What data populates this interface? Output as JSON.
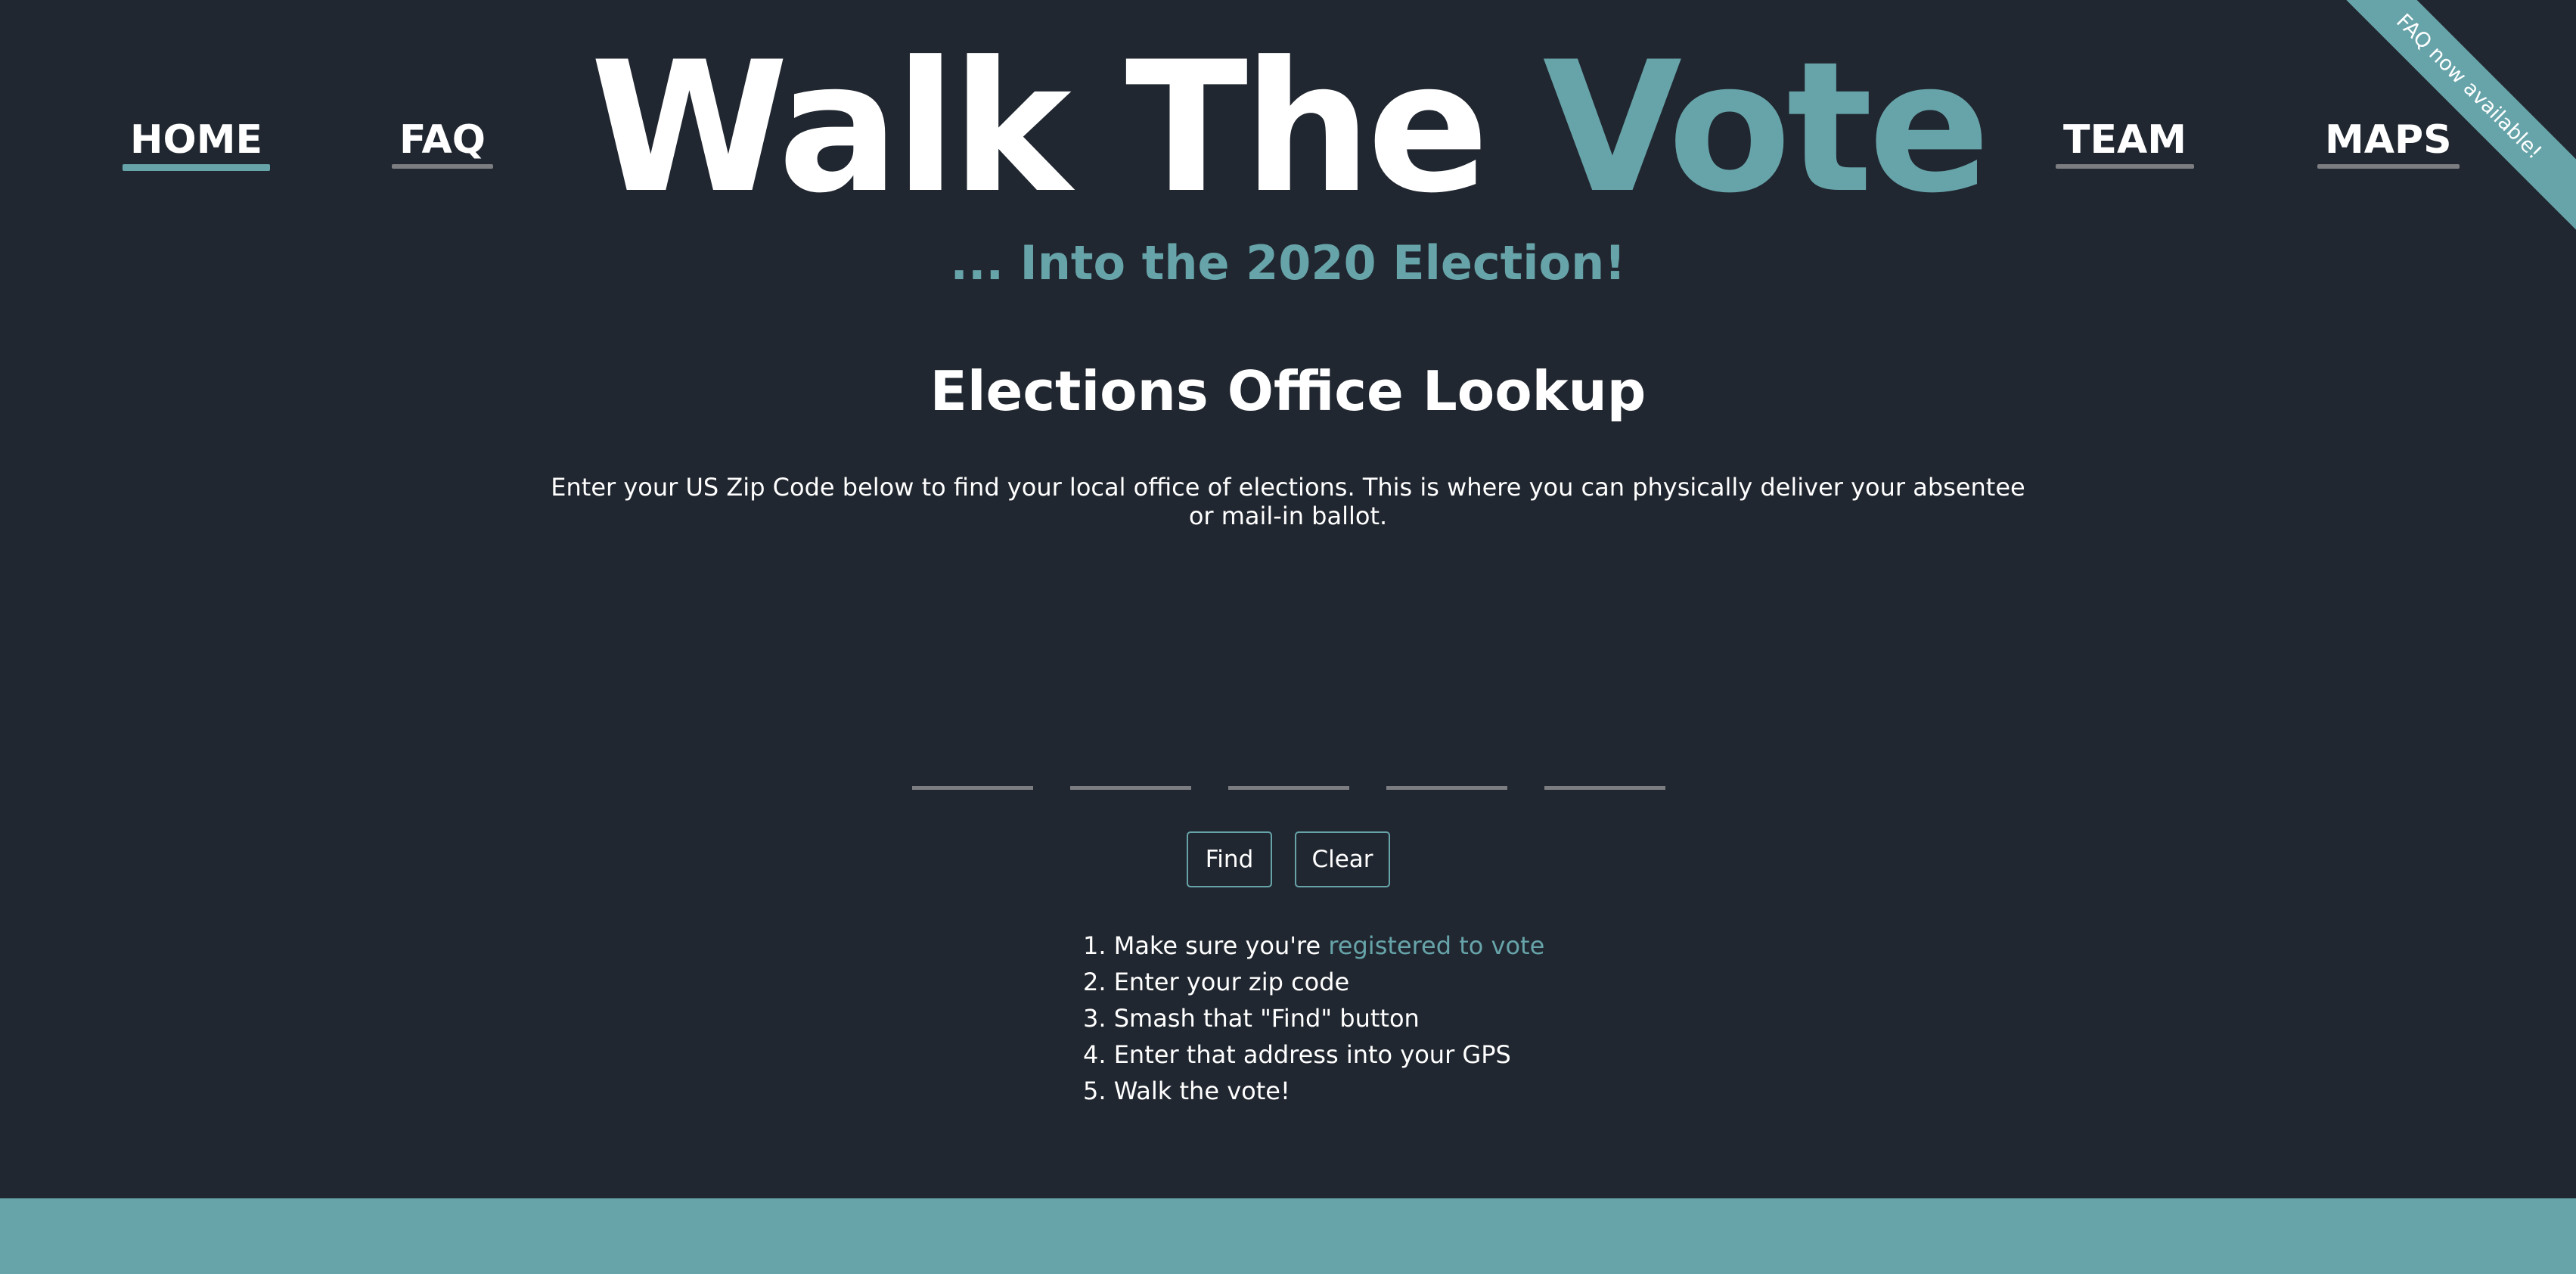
{
  "nav": {
    "home": "HOME",
    "faq": "FAQ",
    "team": "TEAM",
    "maps": "MAPS",
    "active": "HOME"
  },
  "logo": {
    "part1": "Walk The ",
    "part2": "Vote"
  },
  "subtitle": "... Into the 2020 Election!",
  "ribbon": "FAQ now available!",
  "lookup": {
    "title": "Elections Office Lookup",
    "instructions": "Enter your US Zip Code below to find your local office of elections. This is where you can physically deliver your absentee or mail-in ballot.",
    "zip_digits": [
      "",
      "",
      "",
      "",
      ""
    ],
    "find_label": "Find",
    "clear_label": "Clear"
  },
  "steps": [
    {
      "prefix": "1. Make sure you're ",
      "link": "registered to vote"
    },
    {
      "text": "2. Enter your zip code"
    },
    {
      "text": "3. Smash that \"Find\" button"
    },
    {
      "text": "4. Enter that address into your GPS"
    },
    {
      "text": "5. Walk the vote!"
    }
  ],
  "colors": {
    "background": "#212730",
    "accent": "#67a4aa",
    "text": "#ffffff",
    "underline_inactive": "#7b7d81"
  }
}
